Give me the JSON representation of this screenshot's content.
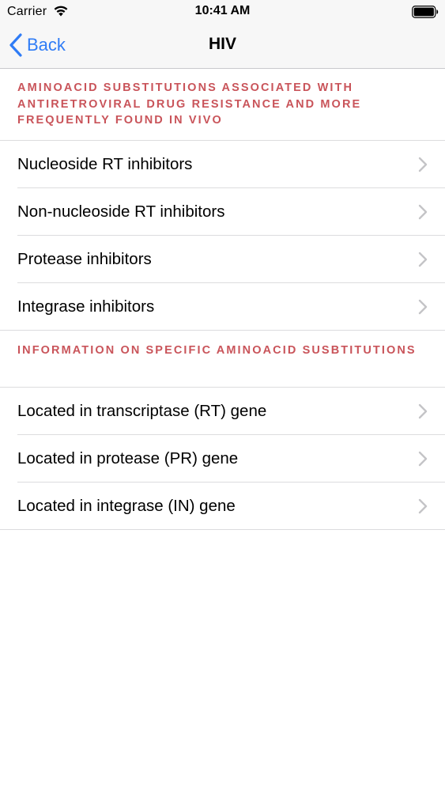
{
  "status": {
    "carrier": "Carrier",
    "time": "10:41 AM"
  },
  "nav": {
    "back_label": "Back",
    "title": "HIV"
  },
  "sections": [
    {
      "header": "AMINOACID SUBSTITUTIONS ASSOCIATED WITH ANTIRETROVIRAL DRUG RESISTANCE AND MORE FREQUENTLY FOUND IN VIVO",
      "items": [
        {
          "label": "Nucleoside RT inhibitors"
        },
        {
          "label": "Non-nucleoside RT inhibitors"
        },
        {
          "label": "Protease inhibitors"
        },
        {
          "label": "Integrase inhibitors"
        }
      ]
    },
    {
      "header": "INFORMATION ON SPECIFIC AMINOACID SUSBTITUTIONS",
      "items": [
        {
          "label": "Located in transcriptase (RT) gene"
        },
        {
          "label": "Located in protease (PR) gene"
        },
        {
          "label": "Located in integrase (IN) gene"
        }
      ]
    }
  ],
  "colors": {
    "accent": "#2f7cf6",
    "section_header": "#c9545a",
    "separator": "#dcdcde",
    "chevron": "#c4c4c7"
  },
  "icons": {
    "back": "chevron-left-icon",
    "disclosure": "chevron-right-icon",
    "wifi": "wifi-icon",
    "battery": "battery-icon"
  }
}
